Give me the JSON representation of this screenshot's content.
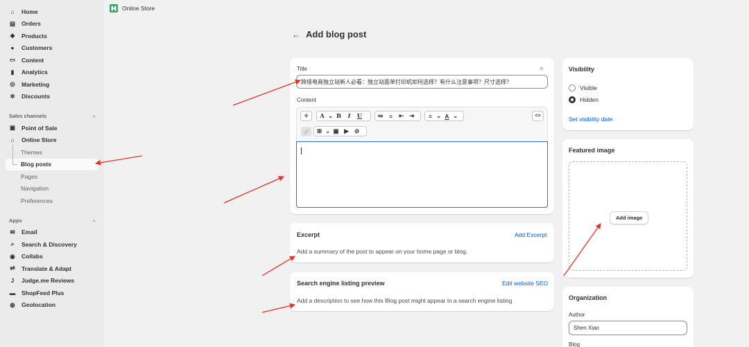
{
  "sidebar": {
    "items": [
      {
        "label": "Home",
        "icon": "home-icon"
      },
      {
        "label": "Orders",
        "icon": "orders-icon"
      },
      {
        "label": "Products",
        "icon": "tag-icon"
      },
      {
        "label": "Customers",
        "icon": "person-icon"
      },
      {
        "label": "Content",
        "icon": "content-icon"
      },
      {
        "label": "Analytics",
        "icon": "bar-chart-icon"
      },
      {
        "label": "Marketing",
        "icon": "target-icon"
      },
      {
        "label": "Discounts",
        "icon": "discount-icon"
      }
    ],
    "sales_channels_label": "Sales channels",
    "sales_channels": [
      {
        "label": "Point of Sale",
        "icon": "pos-icon"
      },
      {
        "label": "Online Store",
        "icon": "store-icon"
      }
    ],
    "online_store_sub": [
      "Themes",
      "Blog posts",
      "Pages",
      "Navigation",
      "Preferences"
    ],
    "apps_label": "Apps",
    "apps": [
      {
        "label": "Email",
        "icon": "mail-icon"
      },
      {
        "label": "Search & Discovery",
        "icon": "search-icon"
      },
      {
        "label": "Collabs",
        "icon": "collabs-icon"
      },
      {
        "label": "Translate & Adapt",
        "icon": "translate-icon"
      },
      {
        "label": "Judge.me Reviews",
        "icon": "judgeme-icon"
      },
      {
        "label": "ShopFeed Plus",
        "icon": "shopfeed-icon"
      },
      {
        "label": "Geolocation",
        "icon": "globe-icon"
      }
    ]
  },
  "topbar": {
    "title": "Online Store"
  },
  "page": {
    "title": "Add blog post"
  },
  "main_card": {
    "title_label": "Title",
    "title_value": "跨境电商独立站新人必看：独立站面单打印机如何选择？有什么注意事项？尺寸选择？",
    "content_label": "Content"
  },
  "excerpt": {
    "title": "Excerpt",
    "action": "Add Excerpt",
    "description": "Add a summary of the post to appear on your home page or blog."
  },
  "seo": {
    "title": "Search engine listing preview",
    "action": "Edit website SEO",
    "description": "Add a description to see how this Blog post might appear in a search engine listing"
  },
  "visibility": {
    "title": "Visibility",
    "options": [
      "Visible",
      "Hidden"
    ],
    "selected": "Hidden",
    "link": "Set visibility date"
  },
  "featured_image": {
    "title": "Featured image",
    "button": "Add image"
  },
  "organization": {
    "title": "Organization",
    "author_label": "Author",
    "author_value": "Shen Xiao",
    "blog_label": "Blog"
  },
  "colors": {
    "accent": "#005bd3",
    "arrow": "#e53322",
    "focus": "#2c6ecb"
  }
}
